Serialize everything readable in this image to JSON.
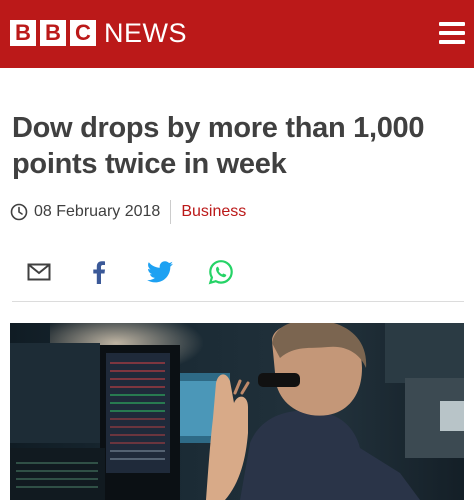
{
  "header": {
    "brand_letters": [
      "B",
      "B",
      "C"
    ],
    "brand_word": "NEWS",
    "menu_icon": "hamburger-menu-icon",
    "background_color": "#bb1919"
  },
  "article": {
    "headline": "Dow drops by more than 1,000 points twice in week",
    "date": "08 February 2018",
    "section": "Business",
    "section_color": "#bb1919"
  },
  "share": {
    "icons": [
      "email-icon",
      "facebook-icon",
      "twitter-icon",
      "whatsapp-icon"
    ],
    "colors": {
      "email": "#404040",
      "facebook": "#3b5998",
      "twitter": "#1da1f2",
      "whatsapp": "#25d366"
    }
  },
  "hero_image": {
    "description_icon": "trader-photo"
  }
}
